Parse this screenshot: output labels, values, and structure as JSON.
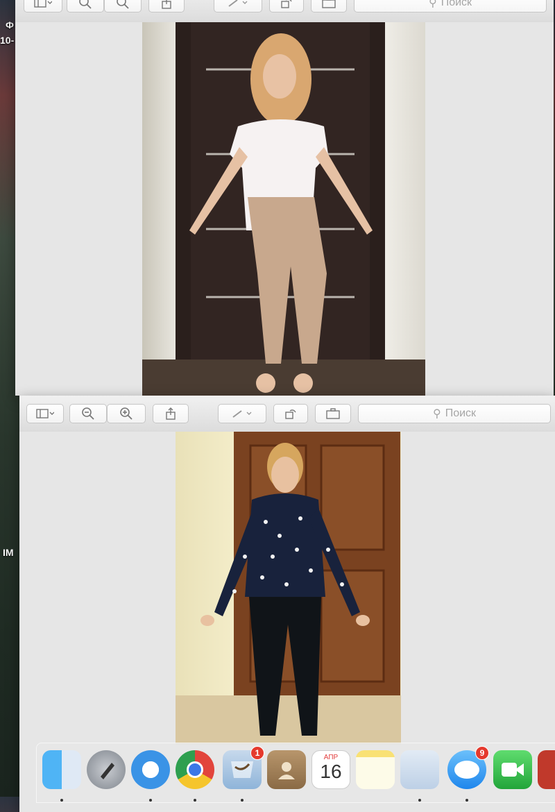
{
  "desktop": {
    "label_top_1": "Ф",
    "label_top_2": "10-",
    "label_mid": "IM"
  },
  "window_top": {
    "search_placeholder": "Поиск"
  },
  "window_bottom": {
    "search_placeholder": "Поиск"
  },
  "dock": {
    "calendar_month": "АПР",
    "calendar_day": "16",
    "mail_badge": "1",
    "messages_badge": "9"
  },
  "colors": {
    "toolbar_bg": "#dcdcdc",
    "content_bg": "#e6e6e6",
    "badge": "#e5392d"
  }
}
